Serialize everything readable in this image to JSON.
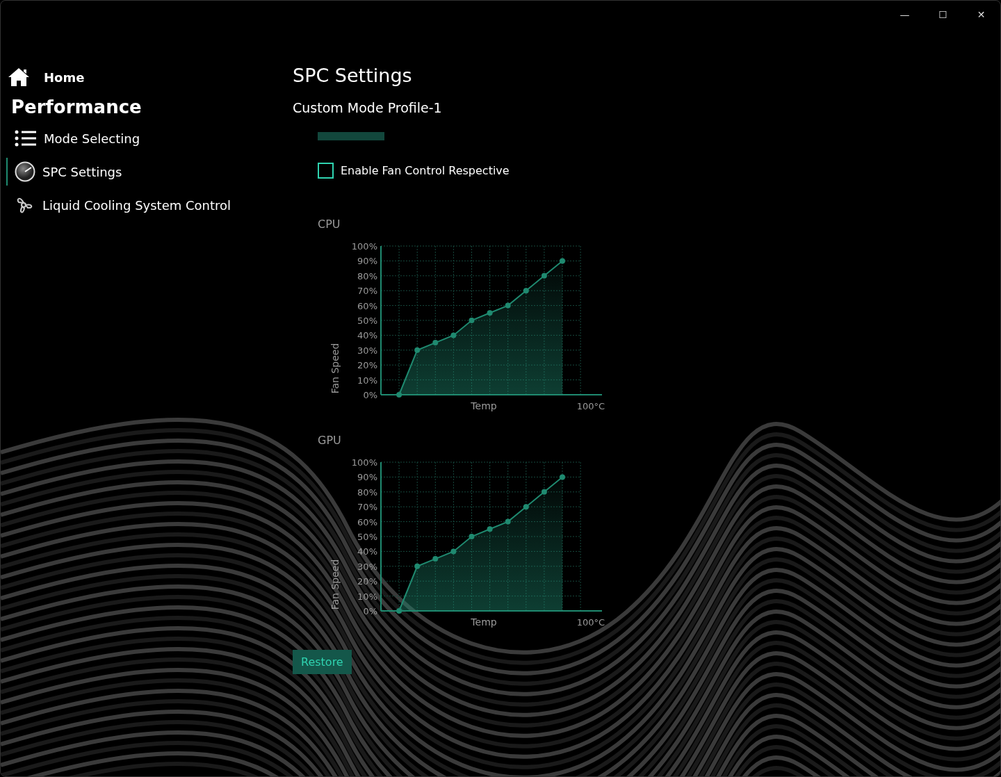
{
  "window_controls": {
    "minimize": "—",
    "maximize": "☐",
    "close": "✕"
  },
  "sidebar": {
    "home": "Home",
    "section": "Performance",
    "items": [
      {
        "label": "Mode Selecting",
        "selected": false
      },
      {
        "label": "SPC Settings",
        "selected": true
      },
      {
        "label": "Liquid Cooling System Control",
        "selected": false
      }
    ]
  },
  "page": {
    "title": "SPC Settings",
    "subtitle": "Custom Mode Profile-1"
  },
  "checkbox": {
    "label": "Enable Fan Control Respective",
    "checked": false
  },
  "charts": [
    {
      "label": "CPU",
      "chart_data": {
        "type": "area",
        "grid": true,
        "xlabel": "Temp",
        "ylabel": "Fan Speed",
        "series": [
          {
            "color": "#1f8a70",
            "values": [
              0,
              30,
              35,
              40,
              50,
              55,
              60,
              70,
              80,
              90
            ]
          }
        ],
        "ylim": [
          0,
          100
        ],
        "yticks": [
          {
            "value": 0,
            "label": "0%"
          },
          {
            "value": 10,
            "label": "10%"
          },
          {
            "value": 20,
            "label": "20%"
          },
          {
            "value": 30,
            "label": "30%"
          },
          {
            "value": 40,
            "label": "40%"
          },
          {
            "value": 50,
            "label": "50%"
          },
          {
            "value": 60,
            "label": "60%"
          },
          {
            "value": 70,
            "label": "70%"
          },
          {
            "value": 80,
            "label": "80%"
          },
          {
            "value": 90,
            "label": "90%"
          },
          {
            "value": 100,
            "label": "100%"
          }
        ],
        "annotations": [
          {
            "text": "100°C"
          }
        ]
      }
    },
    {
      "label": "GPU",
      "chart_data": {
        "type": "area",
        "grid": true,
        "xlabel": "Temp",
        "ylabel": "Fan Speed",
        "series": [
          {
            "color": "#1f8a70",
            "values": [
              0,
              30,
              35,
              40,
              50,
              55,
              60,
              70,
              80,
              90
            ]
          }
        ],
        "ylim": [
          0,
          100
        ],
        "yticks": [
          {
            "value": 0,
            "label": "0%"
          },
          {
            "value": 10,
            "label": "10%"
          },
          {
            "value": 20,
            "label": "20%"
          },
          {
            "value": 30,
            "label": "30%"
          },
          {
            "value": 40,
            "label": "40%"
          },
          {
            "value": 50,
            "label": "50%"
          },
          {
            "value": 60,
            "label": "60%"
          },
          {
            "value": 70,
            "label": "70%"
          },
          {
            "value": 80,
            "label": "80%"
          },
          {
            "value": 90,
            "label": "90%"
          },
          {
            "value": 100,
            "label": "100%"
          }
        ],
        "annotations": [
          {
            "text": "100°C"
          }
        ]
      }
    }
  ],
  "restore_button": "Restore"
}
